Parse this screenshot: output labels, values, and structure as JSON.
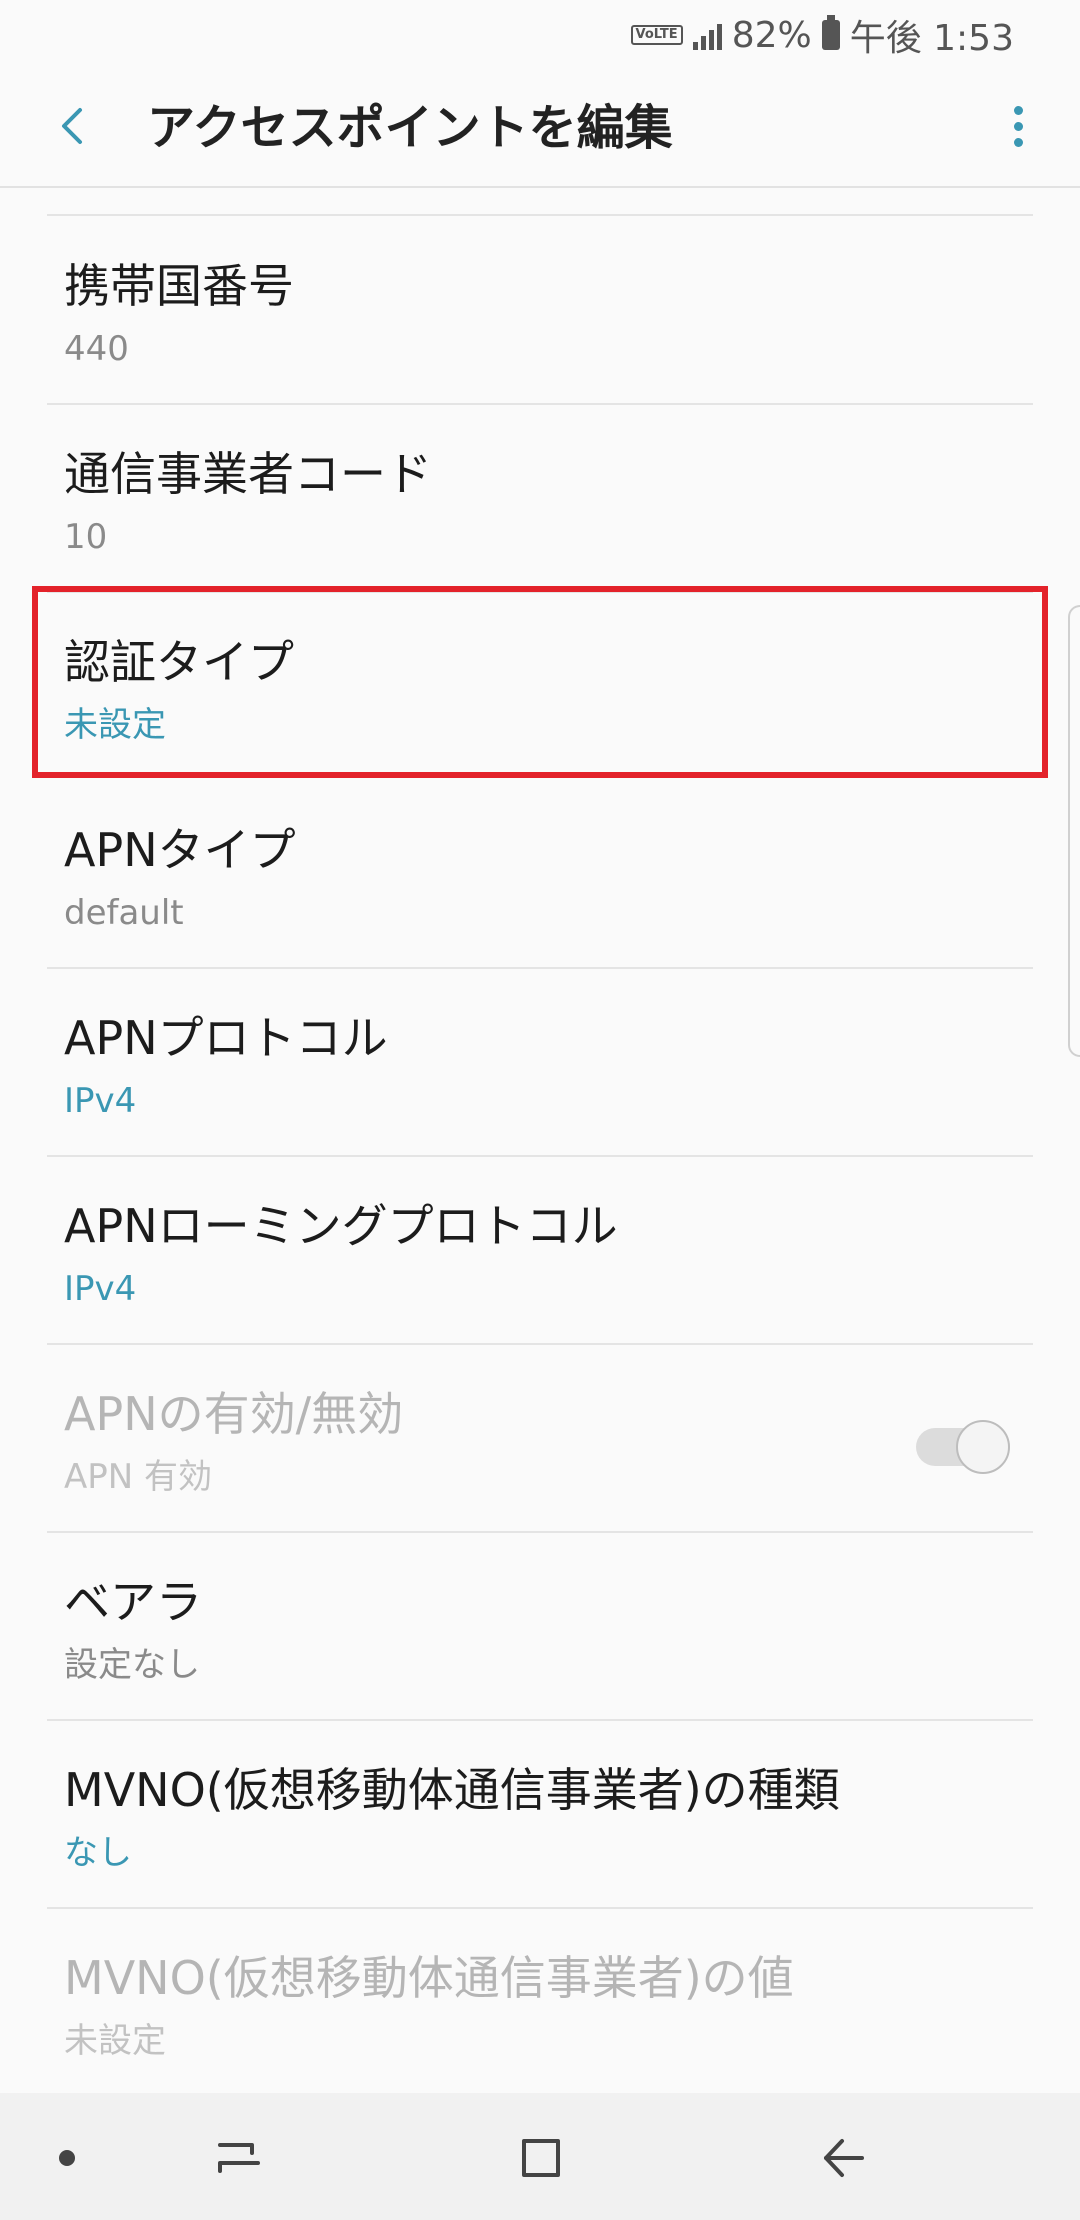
{
  "status_bar": {
    "volte": "VoLTE",
    "battery_percent": "82%",
    "time": "午後 1:53"
  },
  "header": {
    "title": "アクセスポイントを編集",
    "back_icon": "back-arrow-icon",
    "more_icon": "more-vertical-icon"
  },
  "items": [
    {
      "title": "携帯国番号",
      "summary": "440"
    },
    {
      "title": "通信事業者コード",
      "summary": "10"
    },
    {
      "title": "認証タイプ",
      "summary": "未設定"
    },
    {
      "title": "APNタイプ",
      "summary": "default"
    },
    {
      "title": "APNプロトコル",
      "summary": "IPv4"
    },
    {
      "title": "APNローミングプロトコル",
      "summary": "IPv4"
    },
    {
      "title": "APNの有効/無効",
      "summary": "APN 有効",
      "toggle_on": true
    },
    {
      "title": "ベアラ",
      "summary": "設定なし"
    },
    {
      "title": "MVNO(仮想移動体通信事業者)の種類",
      "summary": "なし"
    },
    {
      "title": "MVNO(仮想移動体通信事業者)の値",
      "summary": "未設定"
    }
  ],
  "colors": {
    "accent": "#3a97b3",
    "highlight": "#e3222a"
  },
  "nav_bar": {
    "icons": [
      "dot-icon",
      "recents-icon",
      "home-icon",
      "back-icon"
    ]
  }
}
